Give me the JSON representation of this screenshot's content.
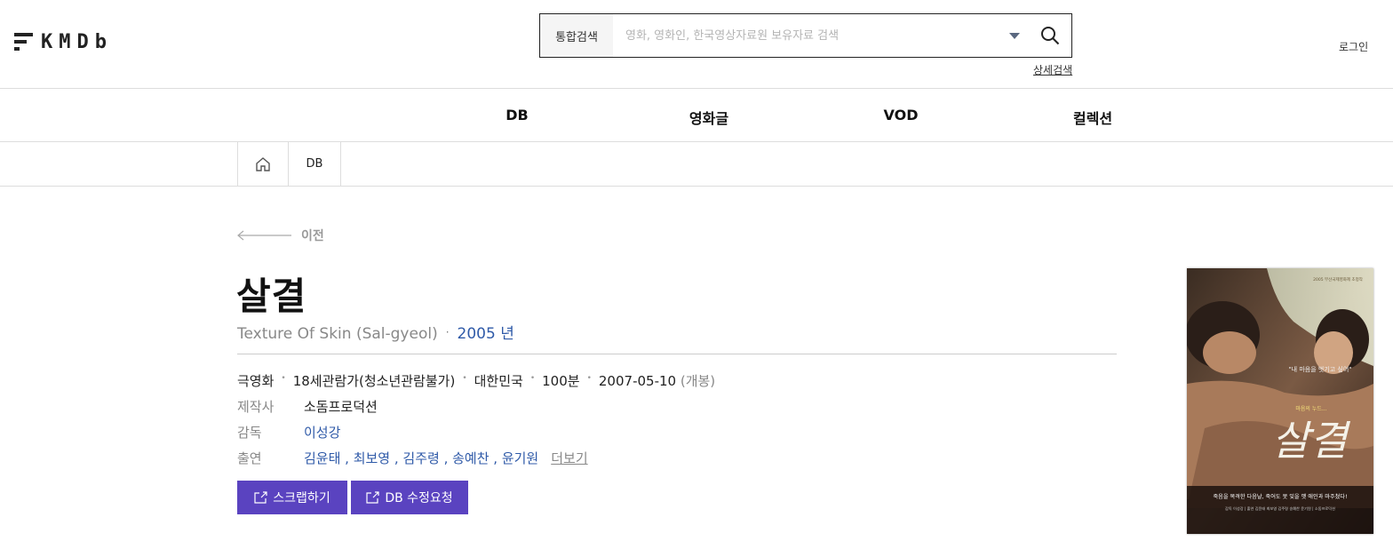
{
  "header": {
    "logo_text": "KMDb",
    "search": {
      "scope": "통합검색",
      "placeholder": "영화, 영화인, 한국영상자료원 보유자료 검색"
    },
    "advanced_search": "상세검색",
    "login": "로그인"
  },
  "nav": {
    "items": [
      {
        "label": "DB"
      },
      {
        "label": "영화글"
      },
      {
        "label": "VOD"
      },
      {
        "label": "컬렉션"
      }
    ]
  },
  "breadcrumb": {
    "items": [
      {
        "label": "DB"
      }
    ]
  },
  "back_label": "이전",
  "movie": {
    "title": "살결",
    "original_title": "Texture Of Skin (Sal-gyeol)",
    "year": "2005 년",
    "genre": "극영화",
    "rating": "18세관람가(청소년관람불가)",
    "country": "대한민국",
    "runtime": "100분",
    "release_date": "2007-05-10",
    "release_note": "(개봉)",
    "producer_label": "제작사",
    "producer": "소돔프로덕션",
    "director_label": "감독",
    "director": "이성강",
    "cast_label": "출연",
    "cast": "김윤태 , 최보영 , 김주령 , 송예찬 , 윤기원",
    "more": "더보기"
  },
  "buttons": {
    "scrap": "스크랩하기",
    "edit_request": "DB 수정요청"
  },
  "poster": {
    "title_text": "살결",
    "tagline": "\"내 마음을 벗기고 싶어\"",
    "small_tag": "마음의 누드...",
    "bottom_line": "죽음을 목격한 다음날, 죽어도 못 잊을 옛 애인과 마주쳤다!",
    "credits": "감독 이성강 | 출연 김윤태 최보영 김주령 송예찬 윤기원 | 소돔프로덕션",
    "award": "2005 부산국제영화제 초청작"
  },
  "colors": {
    "accent_button": "#5a43c0",
    "link_blue": "#2f5aa8"
  }
}
